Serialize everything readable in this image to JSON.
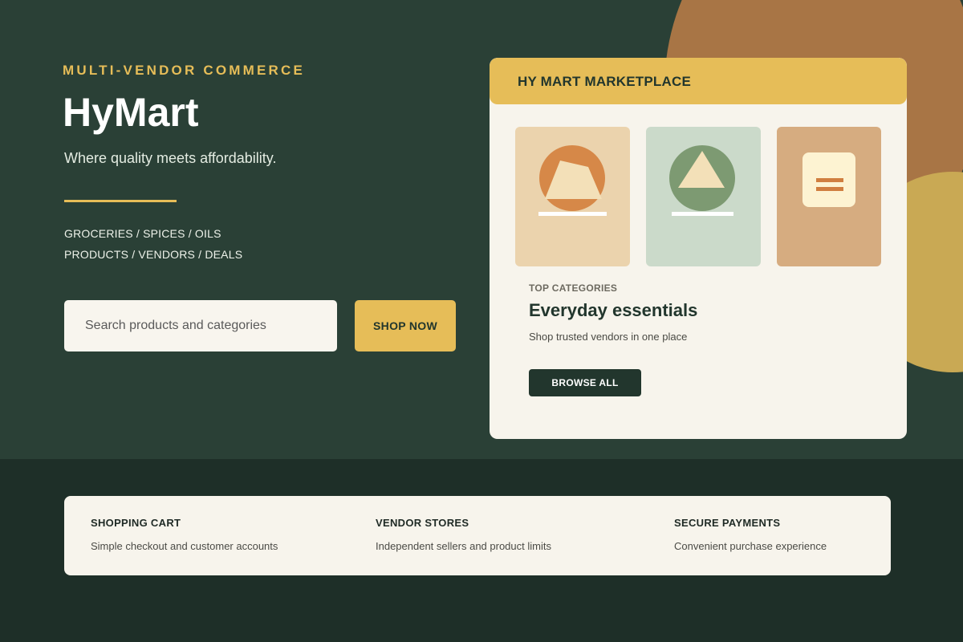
{
  "hero": {
    "eyebrow": "MULTI-VENDOR COMMERCE",
    "brand": "HyMart",
    "tagline": "Where quality meets affordability.",
    "category_lines": [
      "GROCERIES / SPICES / OILS",
      "PRODUCTS / VENDORS / DEALS"
    ],
    "search_placeholder": "Search products and categories",
    "shop_button": "SHOP NOW"
  },
  "card": {
    "header_title": "HY MART MARKETPLACE",
    "tiles": [
      {
        "icon": "mountain-sun-icon"
      },
      {
        "icon": "triangle-leaf-icon"
      },
      {
        "icon": "menu-lines-icon"
      }
    ],
    "sub_label": "TOP CATEGORIES",
    "title": "Everyday essentials",
    "description": "Shop trusted vendors in one place",
    "browse_button": "BROWSE ALL"
  },
  "features": [
    {
      "title": "SHOPPING CART",
      "description": "Simple checkout and customer accounts"
    },
    {
      "title": "VENDOR STORES",
      "description": "Independent sellers and product limits"
    },
    {
      "title": "SECURE PAYMENTS",
      "description": "Convenient purchase experience"
    }
  ],
  "colors": {
    "hero_bg": "#2a4036",
    "footer_bg": "#1e2f28",
    "accent": "#e6bd58",
    "card_bg": "#f7f4ec",
    "dark_text": "#22362d"
  }
}
